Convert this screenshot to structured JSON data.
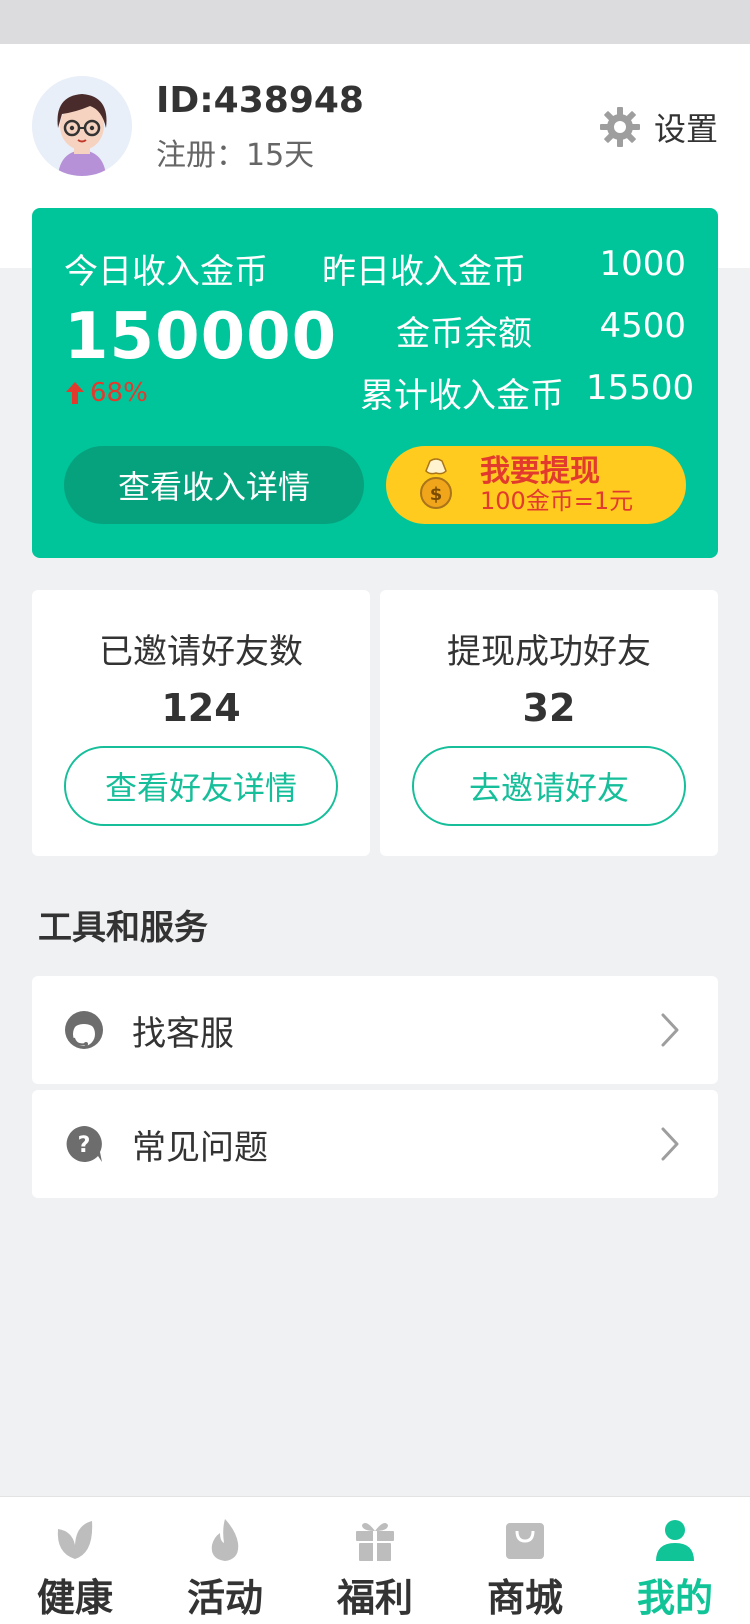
{
  "header": {
    "user_id": "ID:438948",
    "register": "注册：15天",
    "settings_label": "设置"
  },
  "income": {
    "today_label": "今日收入金币",
    "today_value": "150000",
    "today_change": "68%",
    "yesterday_label": "昨日收入金币",
    "yesterday_value": "1000",
    "balance_label": "金币余额",
    "balance_value": "4500",
    "total_label": "累计收入金币",
    "total_value": "15500",
    "detail_button": "查看收入详情",
    "withdraw_title": "我要提现",
    "withdraw_rate": "100金币=1元"
  },
  "friends": {
    "invited_label": "已邀请好友数",
    "invited_count": "124",
    "invited_button": "查看好友详情",
    "withdrawn_label": "提现成功好友",
    "withdrawn_count": "32",
    "invite_button": "去邀请好友"
  },
  "services": {
    "title": "工具和服务",
    "items": [
      {
        "label": "找客服",
        "icon": "customer-service-icon"
      },
      {
        "label": "常见问题",
        "icon": "question-icon"
      }
    ]
  },
  "tabbar": {
    "items": [
      {
        "label": "健康",
        "icon": "leaf-icon"
      },
      {
        "label": "活动",
        "icon": "flame-icon"
      },
      {
        "label": "福利",
        "icon": "gift-icon"
      },
      {
        "label": "商城",
        "icon": "shopping-bag-icon"
      },
      {
        "label": "我的",
        "icon": "user-icon"
      }
    ],
    "active": "我的"
  },
  "colors": {
    "accent": "#00c49a",
    "accent_dark": "#06a27e",
    "withdraw_yellow": "#ffcb1f",
    "alert_red": "#e23b2e",
    "tab_inactive": "#bdbdbd"
  }
}
